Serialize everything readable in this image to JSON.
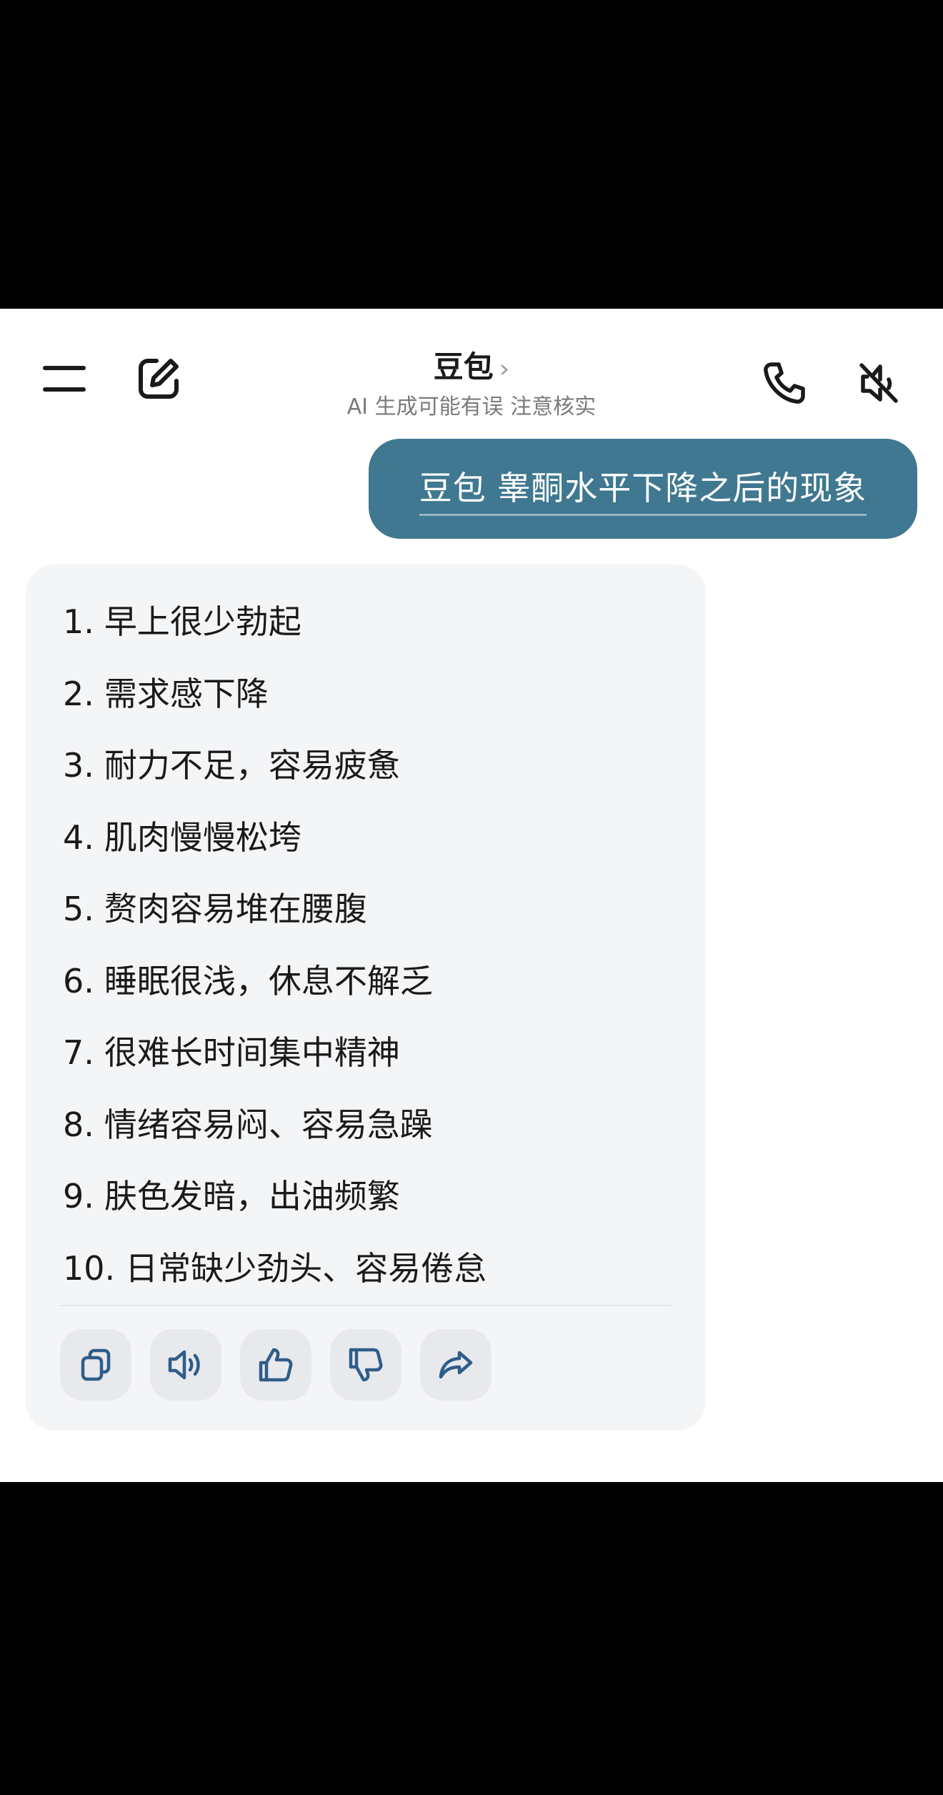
{
  "header": {
    "title": "豆包",
    "title_chevron": "›",
    "subtitle": "AI 生成可能有误 注意核实"
  },
  "user_message": "豆包 睾酮水平下降之后的现象",
  "answer_items": [
    {
      "num": "1.",
      "text": "早上很少勃起"
    },
    {
      "num": "2.",
      "text": "需求感下降"
    },
    {
      "num": "3.",
      "text": "耐力不足，容易疲惫"
    },
    {
      "num": "4.",
      "text": "肌肉慢慢松垮"
    },
    {
      "num": "5.",
      "text": "赘肉容易堆在腰腹"
    },
    {
      "num": "6.",
      "text": "睡眠很浅，休息不解乏"
    },
    {
      "num": "7.",
      "text": "很难长时间集中精神"
    },
    {
      "num": "8.",
      "text": "情绪容易闷、容易急躁"
    },
    {
      "num": "9.",
      "text": "肤色发暗，出油频繁"
    },
    {
      "num": "10.",
      "text": "日常缺少劲头、容易倦怠"
    }
  ],
  "icons": {
    "menu": "menu-icon",
    "new_chat": "edit-icon",
    "call": "phone-icon",
    "mute": "speaker-muted-icon",
    "copy": "copy-icon",
    "read_aloud": "speaker-icon",
    "like": "thumbs-up-icon",
    "dislike": "thumbs-down-icon",
    "share": "share-icon"
  },
  "colors": {
    "user_bubble": "#3f7890",
    "answer_bg": "#f4f5f7",
    "icon_accent": "#2f5d8a"
  }
}
